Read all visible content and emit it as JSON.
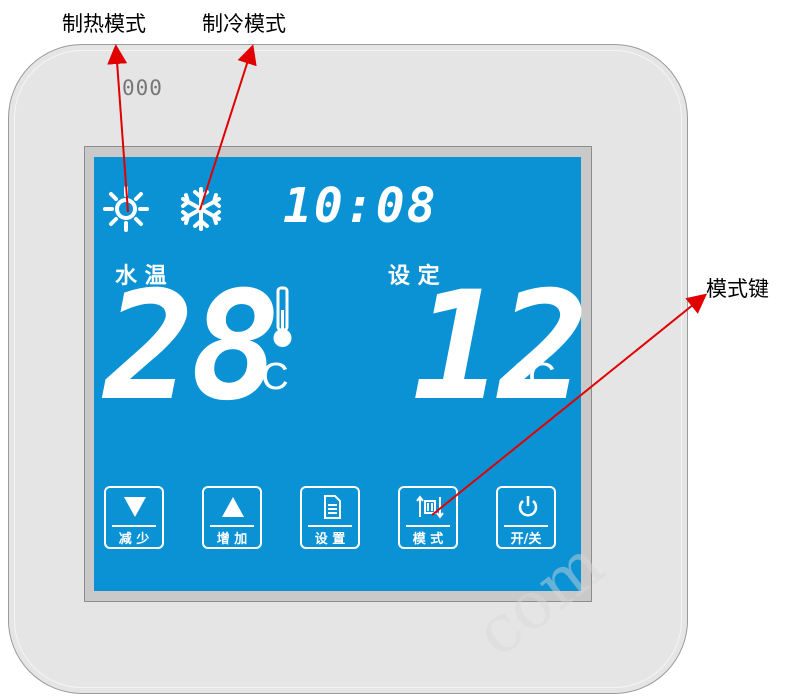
{
  "callouts": {
    "heat_mode": "制热模式",
    "cool_mode": "制冷模式",
    "mode_key": "模式键"
  },
  "device": {
    "brand_mark": "000"
  },
  "lcd": {
    "clock": "10:08",
    "water_temp_label": "水 温",
    "setpoint_label": "设 定",
    "water_temp_value": "28",
    "setpoint_value": "12",
    "temp_unit": "°C"
  },
  "buttons": [
    {
      "label": "减 少",
      "icon": "triangle-down-icon"
    },
    {
      "label": "增 加",
      "icon": "triangle-up-icon"
    },
    {
      "label": "设 置",
      "icon": "settings-document-icon"
    },
    {
      "label": "模 式",
      "icon": "mode-cycle-icon"
    },
    {
      "label": "开/关",
      "icon": "power-icon"
    }
  ],
  "colors": {
    "screen": "#0a92d4",
    "callout_arrow": "#e00000",
    "frame": "#e5e5e5",
    "segment": "#ffffff"
  },
  "watermark": "com"
}
